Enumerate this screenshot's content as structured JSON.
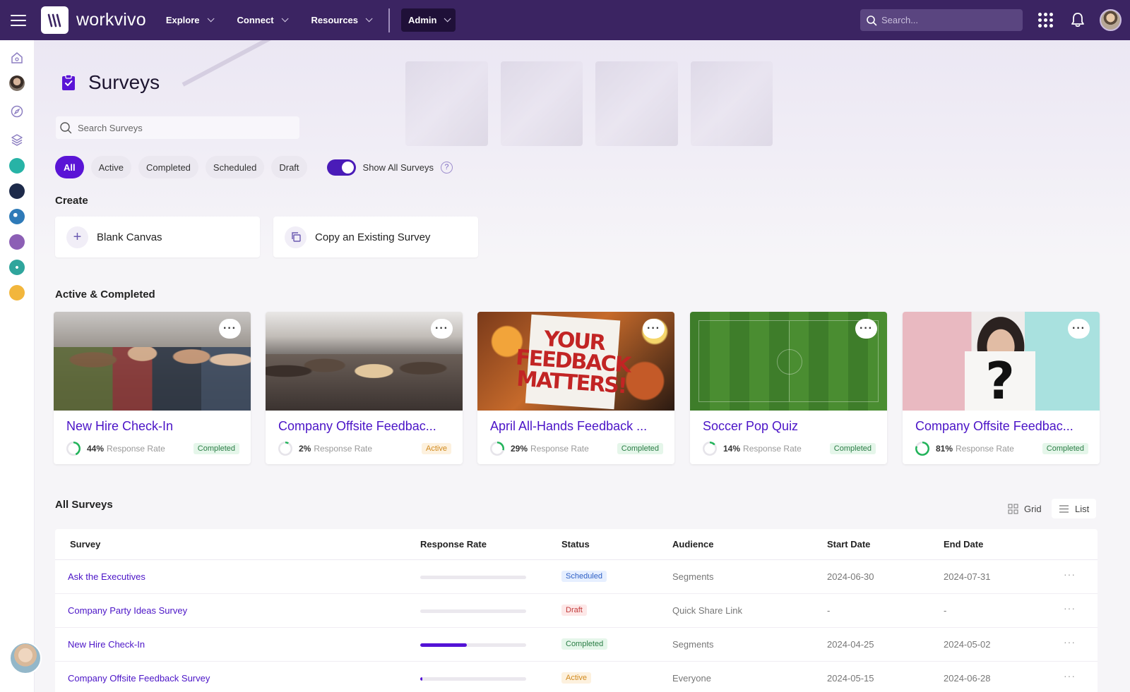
{
  "topbar": {
    "brand": "workvivo",
    "nav": [
      {
        "label": "Explore"
      },
      {
        "label": "Connect"
      },
      {
        "label": "Resources"
      },
      {
        "label": "Admin"
      }
    ],
    "search_placeholder": "Search..."
  },
  "page": {
    "title": "Surveys",
    "search_placeholder": "Search Surveys",
    "filters": [
      "All",
      "Active",
      "Completed",
      "Scheduled",
      "Draft"
    ],
    "active_filter": "All",
    "toggle_label": "Show All Surveys",
    "help_glyph": "?"
  },
  "create": {
    "title": "Create",
    "blank_canvas": "Blank Canvas",
    "copy_existing": "Copy an Existing Survey"
  },
  "active_completed": {
    "title": "Active & Completed",
    "cards": [
      {
        "title": "New Hire Check-In",
        "pct": "44%",
        "pct_value": 44,
        "rate_label": "Response Rate",
        "status": "Completed",
        "status_class": "completed"
      },
      {
        "title": "Company Offsite Feedbac...",
        "pct": "2%",
        "pct_value": 2,
        "rate_label": "Response Rate",
        "status": "Active",
        "status_class": "active"
      },
      {
        "title": "April All-Hands Feedback ...",
        "pct": "29%",
        "pct_value": 29,
        "rate_label": "Response Rate",
        "status": "Completed",
        "status_class": "completed"
      },
      {
        "title": "Soccer Pop Quiz",
        "pct": "14%",
        "pct_value": 14,
        "rate_label": "Response Rate",
        "status": "Completed",
        "status_class": "completed"
      },
      {
        "title": "Company Offsite Feedbac...",
        "pct": "81%",
        "pct_value": 81,
        "rate_label": "Response Rate",
        "status": "Completed",
        "status_class": "completed"
      }
    ],
    "sign_lines": [
      "YOUR",
      "FEEDBACK",
      "MATTERS!"
    ]
  },
  "all_surveys": {
    "title": "All Surveys",
    "view_grid": "Grid",
    "view_list": "List",
    "columns": [
      "Survey",
      "Response Rate",
      "Status",
      "Audience",
      "Start Date",
      "End Date"
    ],
    "rows": [
      {
        "survey": "Ask the Executives",
        "rate": 0,
        "status": "Scheduled",
        "status_class": "scheduled",
        "audience": "Segments",
        "start": "2024-06-30",
        "end": "2024-07-31"
      },
      {
        "survey": "Company Party Ideas Survey",
        "rate": 0,
        "status": "Draft",
        "status_class": "draft",
        "audience": "Quick Share Link",
        "start": "-",
        "end": "-"
      },
      {
        "survey": "New Hire Check-In",
        "rate": 44,
        "status": "Completed",
        "status_class": "completed",
        "audience": "Segments",
        "start": "2024-04-25",
        "end": "2024-05-02"
      },
      {
        "survey": "Company Offsite Feedback Survey",
        "rate": 2,
        "status": "Active",
        "status_class": "active",
        "audience": "Everyone",
        "start": "2024-05-15",
        "end": "2024-06-28"
      }
    ]
  },
  "colors": {
    "topbar": "#3b2462",
    "accent": "#5a14d6",
    "link": "#4b14c7"
  }
}
